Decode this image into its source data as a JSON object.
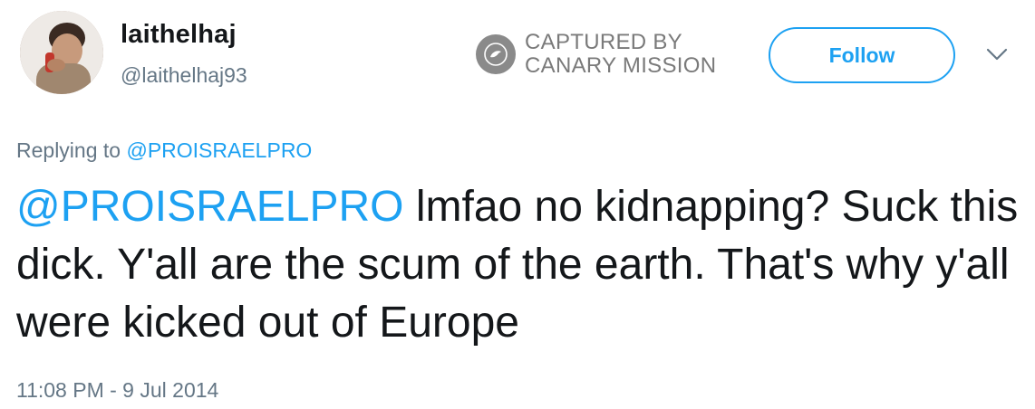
{
  "user": {
    "display_name": "laithelhaj",
    "handle": "@laithelhaj93"
  },
  "watermark": {
    "line1": "CAPTURED BY",
    "line2": "CANARY MISSION",
    "icon": "canary-bird-icon"
  },
  "actions": {
    "follow_label": "Follow",
    "menu_icon": "chevron-down-icon"
  },
  "reply": {
    "prefix": "Replying to",
    "mention": "@PROISRAELPRO"
  },
  "tweet": {
    "mention": "@PROISRAELPRO",
    "body": " lmfao no kidnapping? Suck this dick. Y'all are the scum of the earth. That's why y'all were kicked out of Europe"
  },
  "timestamp": "11:08 PM - 9 Jul 2014",
  "colors": {
    "accent": "#1da1f2",
    "secondary_text": "#657786",
    "primary_text": "#14171a"
  }
}
